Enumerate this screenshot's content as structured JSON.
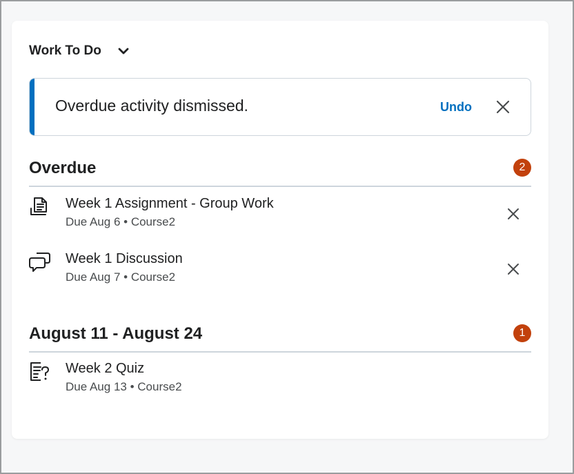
{
  "widget": {
    "title": "Work To Do",
    "chevron_icon": "chevron-down-icon"
  },
  "alert": {
    "message": "Overdue activity dismissed.",
    "undo_label": "Undo",
    "accent_color": "#006fbf"
  },
  "overdue": {
    "title": "Overdue",
    "count": "2",
    "badge_color": "#c2410c",
    "items": [
      {
        "title": "Week 1 Assignment - Group Work",
        "due": "Due Aug 6",
        "separator": "•",
        "course": "Course2",
        "icon": "assignment-icon"
      },
      {
        "title": "Week 1 Discussion",
        "due": "Due Aug 7",
        "separator": "•",
        "course": "Course2",
        "icon": "discussion-icon"
      }
    ]
  },
  "upcoming": {
    "title": "August 11 - August 24",
    "count": "1",
    "items": [
      {
        "title": "Week 2 Quiz",
        "due": "Due Aug 13",
        "separator": "•",
        "course": "Course2",
        "icon": "quiz-icon"
      }
    ]
  }
}
